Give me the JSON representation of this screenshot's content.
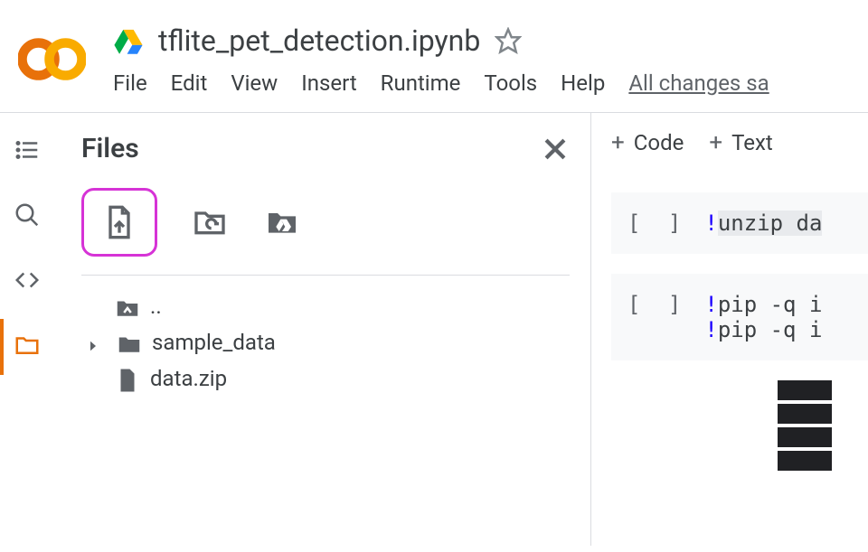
{
  "header": {
    "doc_title": "tflite_pet_detection.ipynb",
    "menus": [
      "File",
      "Edit",
      "View",
      "Insert",
      "Runtime",
      "Tools",
      "Help"
    ],
    "status": "All changes sa"
  },
  "panel": {
    "title": "Files",
    "tree": {
      "parent": "..",
      "folder1": "sample_data",
      "file1": "data.zip"
    }
  },
  "notebook": {
    "toolbar": {
      "code": "Code",
      "text": "Text"
    },
    "cell1_bracket": "[ ]",
    "cell1_bang": "!",
    "cell1_code": "unzip da",
    "cell2_bracket": "[ ]",
    "cell2_line1_bang": "!",
    "cell2_line1": "pip -q i",
    "cell2_line2_bang": "!",
    "cell2_line2": "pip -q i"
  }
}
